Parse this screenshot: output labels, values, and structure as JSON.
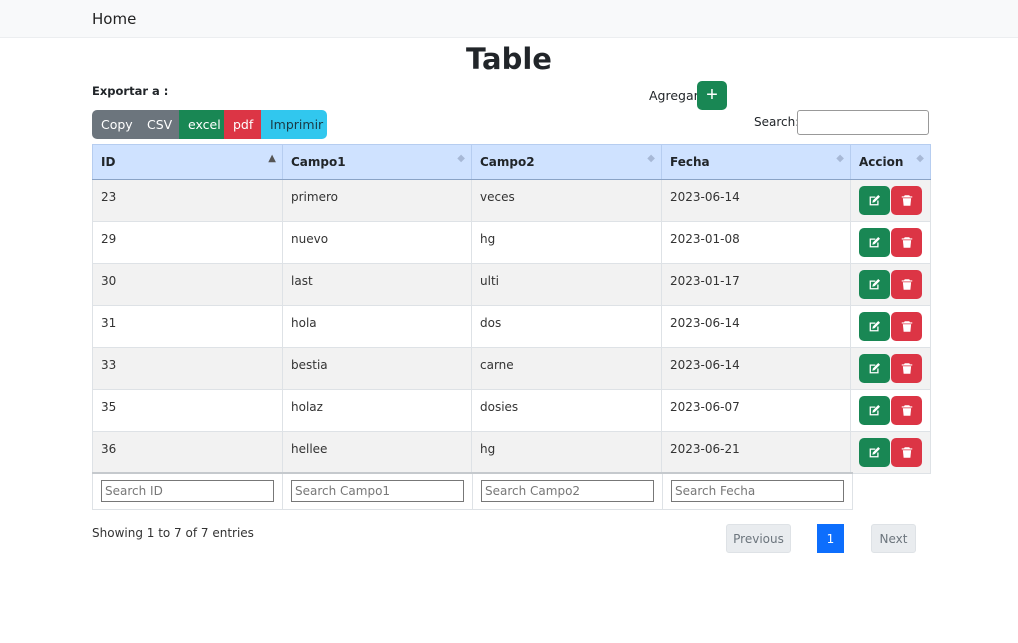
{
  "nav": {
    "home": "Home"
  },
  "page": {
    "title": "Table"
  },
  "export": {
    "label": "Exportar a :",
    "buttons": {
      "copy": "Copy",
      "csv": "CSV",
      "excel": "excel",
      "pdf": "pdf",
      "print": "Imprimir"
    }
  },
  "add": {
    "label": "Agregar",
    "icon": "plus-icon"
  },
  "search": {
    "label": "Search:",
    "value": ""
  },
  "table": {
    "columns": [
      "ID",
      "Campo1",
      "Campo2",
      "Fecha",
      "Accion"
    ],
    "sorted_column": "ID",
    "sort_direction": "asc",
    "rows": [
      {
        "id": "23",
        "campo1": "primero",
        "campo2": "veces",
        "fecha": "2023-06-14"
      },
      {
        "id": "29",
        "campo1": "nuevo",
        "campo2": "hg",
        "fecha": "2023-01-08"
      },
      {
        "id": "30",
        "campo1": "last",
        "campo2": "ulti",
        "fecha": "2023-01-17"
      },
      {
        "id": "31",
        "campo1": "hola",
        "campo2": "dos",
        "fecha": "2023-06-14"
      },
      {
        "id": "33",
        "campo1": "bestia",
        "campo2": "carne",
        "fecha": "2023-06-14"
      },
      {
        "id": "35",
        "campo1": "holaz",
        "campo2": "dosies",
        "fecha": "2023-06-07"
      },
      {
        "id": "36",
        "campo1": "hellee",
        "campo2": "hg",
        "fecha": "2023-06-21"
      }
    ],
    "actions": {
      "edit_icon": "edit-icon",
      "delete_icon": "trash-icon"
    }
  },
  "footer_search": {
    "placeholders": [
      "Search ID",
      "Search Campo1",
      "Search Campo2",
      "Search Fecha"
    ]
  },
  "info": "Showing 1 to 7 of 7 entries",
  "pagination": {
    "previous": "Previous",
    "current_page": "1",
    "next": "Next"
  },
  "colors": {
    "header_bg": "#cfe2ff",
    "success": "#198754",
    "danger": "#dc3545",
    "secondary": "#6c757d",
    "info": "#31c7ee",
    "primary": "#0d6efd"
  }
}
